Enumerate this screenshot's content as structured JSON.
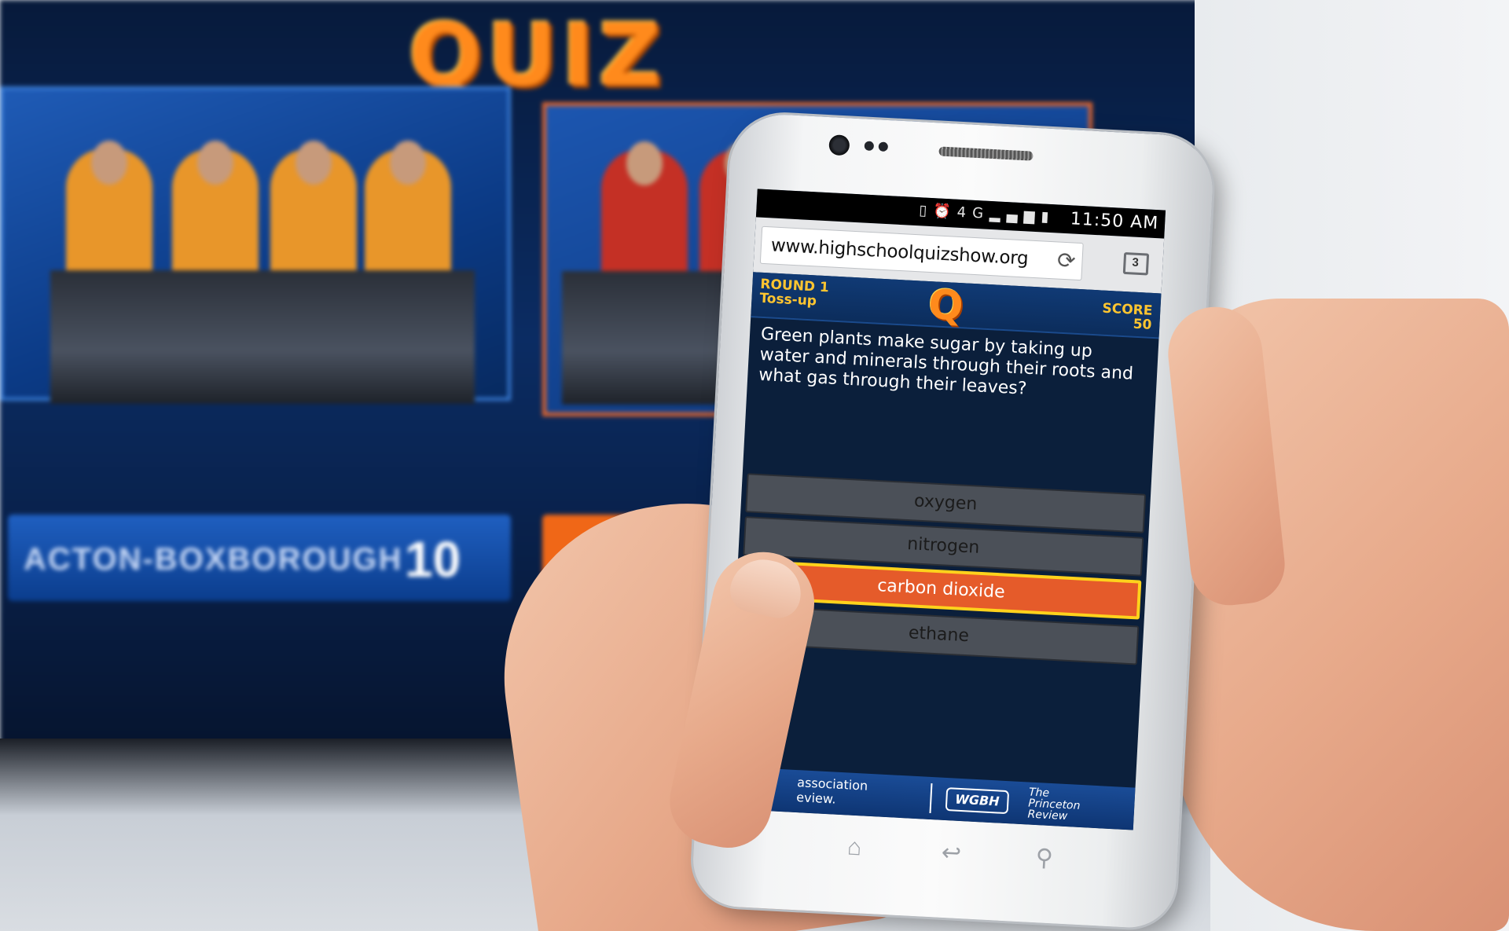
{
  "tv": {
    "show_logo": "QUIZ",
    "team_left_name": "ACTON-BOXBOROUGH",
    "team_left_score": "10"
  },
  "status_bar": {
    "network": "4G",
    "battery": "75%",
    "time": "11:50 AM"
  },
  "browser": {
    "url": "www.highschoolquizshow.org",
    "tab_count": "3",
    "reload_icon": "reload-icon",
    "tabs_icon": "tabs-icon"
  },
  "game": {
    "round_label": "ROUND 1",
    "round_type": "Toss-up",
    "logo_letter": "Q",
    "score_label": "SCORE",
    "score_value": "50",
    "question": "Green plants make sugar by taking up water and minerals through their roots and what gas through their leaves?",
    "answers": [
      {
        "label": "oxygen",
        "selected": false
      },
      {
        "label": "nitrogen",
        "selected": false
      },
      {
        "label": "carbon dioxide",
        "selected": true
      },
      {
        "label": "ethane",
        "selected": false
      }
    ]
  },
  "sponsors": {
    "text_line1": "association",
    "text_line2": "eview.",
    "wgbh": "WGBH",
    "princeton_line1": "The",
    "princeton_line2": "Princeton",
    "princeton_line3": "Review"
  },
  "colors": {
    "answer_selected_bg": "#e55b2a",
    "answer_selected_border": "#ffd21c",
    "accent_yellow": "#ffc530",
    "logo_orange": "#ff8a1c"
  }
}
